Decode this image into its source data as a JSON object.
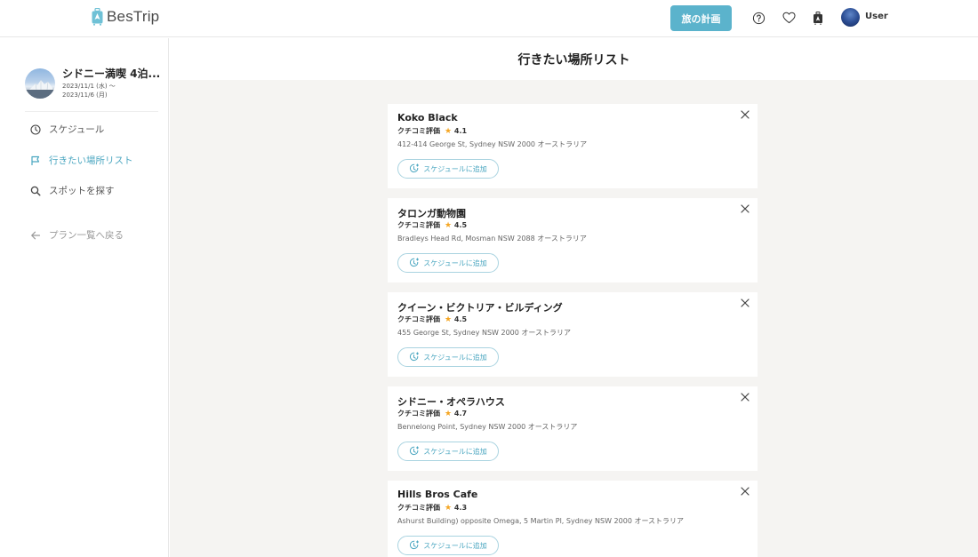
{
  "header": {
    "logo_text": "BesTrip",
    "plan_button": "旅の計画",
    "user_name": "User"
  },
  "sidebar": {
    "trip_title": "シドニー満喫 4泊...",
    "trip_date_start": "2023/11/1 (水) 〜",
    "trip_date_end": "2023/11/6 (月)",
    "items": [
      {
        "label": "スケジュール",
        "icon": "clock-icon"
      },
      {
        "label": "行きたい場所リスト",
        "icon": "flag-icon",
        "active": true
      },
      {
        "label": "スポットを探す",
        "icon": "search-icon"
      }
    ],
    "back_label": "プラン一覧へ戻る"
  },
  "main": {
    "title": "行きたい場所リスト",
    "rating_label": "クチコミ評価",
    "add_label": "スケジュールに追加",
    "places": [
      {
        "name": "Koko Black",
        "rating": "4.1",
        "address": "412-414 George St, Sydney NSW 2000 オーストラリア"
      },
      {
        "name": "タロンガ動物園",
        "rating": "4.5",
        "address": "Bradleys Head Rd, Mosman NSW 2088 オーストラリア"
      },
      {
        "name": "クイーン・ビクトリア・ビルディング",
        "rating": "4.5",
        "address": "455 George St, Sydney NSW 2000 オーストラリア"
      },
      {
        "name": "シドニー・オペラハウス",
        "rating": "4.7",
        "address": "Bennelong Point, Sydney NSW 2000 オーストラリア"
      },
      {
        "name": "Hills Bros Cafe",
        "rating": "4.3",
        "address": "Ashurst Building) opposite Omega, 5 Martin Pl, Sydney NSW 2000 オーストラリア"
      }
    ]
  },
  "colors": {
    "accent": "#5bb3cc",
    "accent_text": "#4aa6c0",
    "star": "#f5a623",
    "main_bg": "#f5f4f2"
  }
}
